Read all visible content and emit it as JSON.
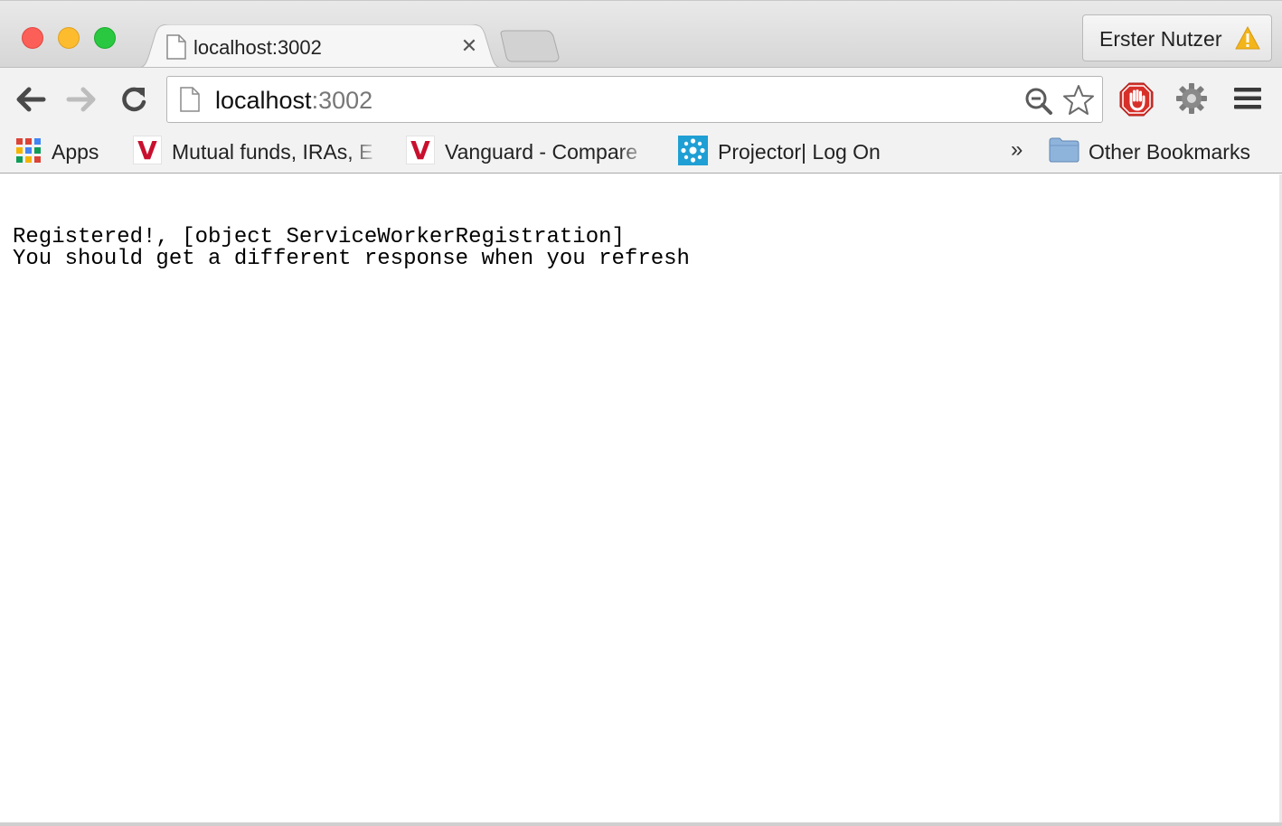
{
  "window": {
    "tab": {
      "title": "localhost:3002",
      "close_glyph": "✕"
    },
    "profile": {
      "name": "Erster Nutzer",
      "icon": "warning-icon"
    }
  },
  "toolbar": {
    "url_host": "localhost",
    "url_port": ":3002",
    "icons": [
      "back-arrow-icon",
      "forward-arrow-icon",
      "reload-icon",
      "page-icon",
      "zoom-icon",
      "star-icon",
      "adblock-icon",
      "extension-gear-icon",
      "menu-icon"
    ]
  },
  "bookmarks": {
    "items": [
      {
        "label": "Apps",
        "icon": "apps-grid-icon"
      },
      {
        "label": "Mutual funds, IRAs, E",
        "icon": "vanguard-v-icon"
      },
      {
        "label": "Vanguard - Compare",
        "icon": "vanguard-v-icon"
      },
      {
        "label": "Projector| Log On",
        "icon": "projector-icon"
      }
    ],
    "overflow": "»",
    "other": {
      "label": "Other Bookmarks",
      "icon": "folder-icon"
    }
  },
  "page": {
    "lines": [
      "Registered!, [object ServiceWorkerRegistration]",
      "You should get a different response when you refresh"
    ]
  },
  "colors": {
    "close": "#fc5f57",
    "minimize": "#fdbc2e",
    "maximize": "#29c840",
    "vanguard_red": "#c8102e",
    "adblock_red": "#d7302a",
    "warning_yellow": "#f3b51b"
  }
}
